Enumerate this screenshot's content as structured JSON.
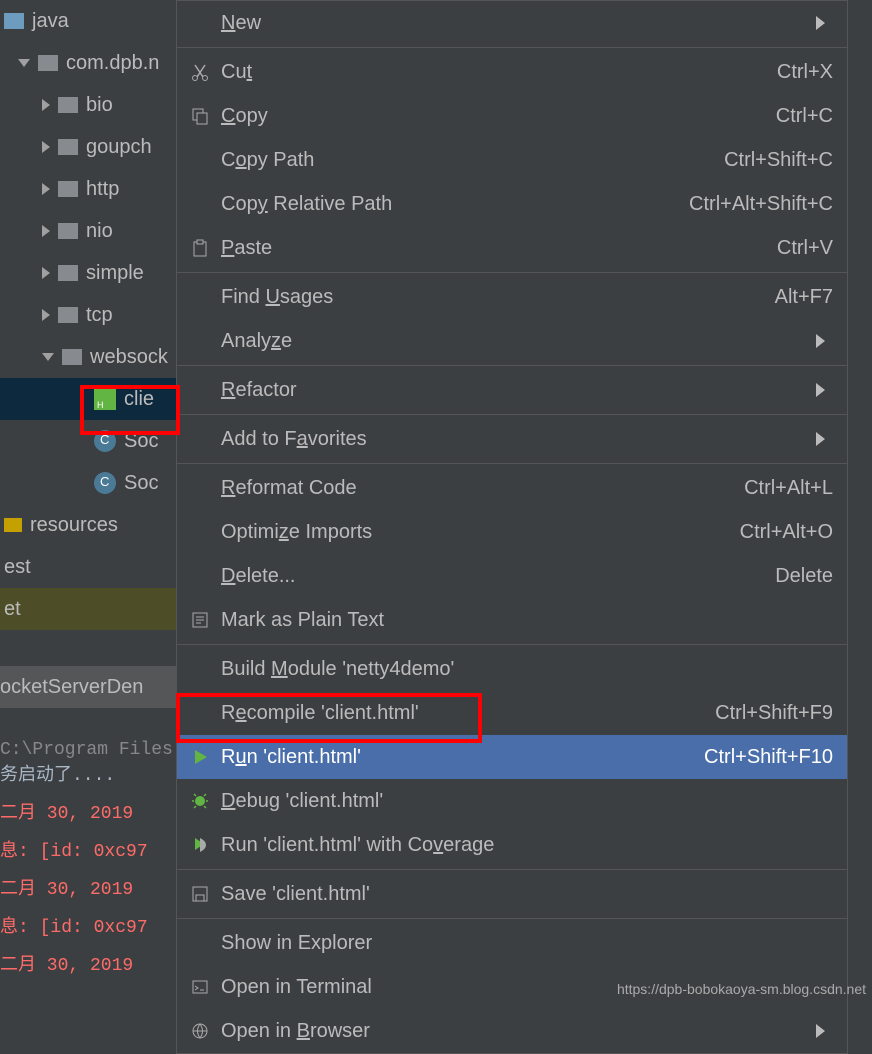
{
  "tree": {
    "java": "java",
    "pkg": "com.dpb.n",
    "bio": "bio",
    "goupch": "goupch",
    "http": "http",
    "nio": "nio",
    "simple": "simple",
    "tcp": "tcp",
    "websock": "websock",
    "clie": "clie",
    "soc1": "Soc",
    "soc2": "Soc",
    "resources": "resources",
    "est": "est",
    "et": "et",
    "server": "ocketServerDen"
  },
  "menu": {
    "new": "New",
    "cut": "Cut",
    "cut_sc": "Ctrl+X",
    "copy": "Copy",
    "copy_sc": "Ctrl+C",
    "copypath": "Copy Path",
    "copypath_sc": "Ctrl+Shift+C",
    "copyrelpath": "Copy Relative Path",
    "copyrelpath_sc": "Ctrl+Alt+Shift+C",
    "paste": "Paste",
    "paste_sc": "Ctrl+V",
    "findusages": "Find Usages",
    "findusages_sc": "Alt+F7",
    "analyze": "Analyze",
    "refactor": "Refactor",
    "addfav": "Add to Favorites",
    "reformat": "Reformat Code",
    "reformat_sc": "Ctrl+Alt+L",
    "optimports": "Optimize Imports",
    "optimports_sc": "Ctrl+Alt+O",
    "delete": "Delete...",
    "delete_sc": "Delete",
    "markplain": "Mark as Plain Text",
    "buildmod": "Build Module 'netty4demo'",
    "recompile": "Recompile 'client.html'",
    "recompile_sc": "Ctrl+Shift+F9",
    "run": "Run 'client.html'",
    "run_sc": "Ctrl+Shift+F10",
    "debug": "Debug 'client.html'",
    "runcov": "Run 'client.html' with Coverage",
    "save": "Save 'client.html'",
    "showexp": "Show in Explorer",
    "openterm": "Open in Terminal",
    "openbrowser": "Open in Browser"
  },
  "console": {
    "path": "C:\\Program Files",
    "started": "务启动了....",
    "date": "二月 30, 2019",
    "info": "息: [id: 0xc97"
  },
  "watermark": "https://dpb-bobokaoya-sm.blog.csdn.net"
}
